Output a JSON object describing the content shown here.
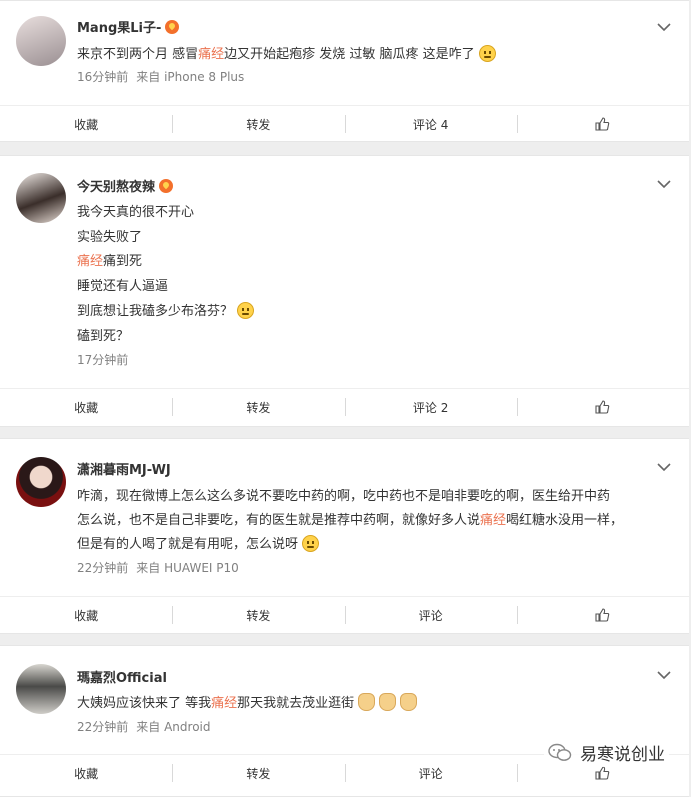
{
  "posts": [
    {
      "username": "Mang果Li子-",
      "lines": [
        [
          "来京不到两个月 感冒",
          "痛经",
          "边又开始起疱疹 发烧 过敏 脑瓜疼 这是咋了"
        ]
      ],
      "time": "16分钟前",
      "source": "来自 iPhone 8 Plus",
      "actions": {
        "favorite": "收藏",
        "repost": "转发",
        "comment": "评论 4"
      }
    },
    {
      "username": "今天别熬夜辣",
      "lines": [
        "我今天真的很不开心",
        "实验失败了",
        "痛经",
        "痛到死",
        "睡觉还有人逼逼",
        "到底想让我磕多少布洛芬？",
        "磕到死？"
      ],
      "time": "17分钟前",
      "source": "",
      "actions": {
        "favorite": "收藏",
        "repost": "转发",
        "comment": "评论 2"
      }
    },
    {
      "username": "潇湘暮雨MJ-WJ",
      "lines": [
        "咋滴，现在微博上怎么这么多说不要吃中药的啊，吃中药也不是咱非要吃的啊，医生给开中药",
        "怎么说，也不是自己非要吃，有的医生就是推荐中药啊，就像好多人说",
        "痛经",
        "喝红糖水没用一样，",
        "但是有的人喝了就是有用呢，怎么说呀"
      ],
      "time": "22分钟前",
      "source": "来自 HUAWEI P10",
      "actions": {
        "favorite": "收藏",
        "repost": "转发",
        "comment": "评论"
      }
    },
    {
      "username": "瑪嘉烈Official",
      "lines": [
        "大姨妈应该快来了 等我",
        "痛经",
        "那天我就去茂业逛街"
      ],
      "time": "22分钟前",
      "source": "来自 Android",
      "actions": {
        "favorite": "收藏",
        "repost": "转发",
        "comment": "评论"
      }
    }
  ],
  "watermark": "易寒说创业",
  "colors": {
    "highlight": "#eb7350",
    "meta": "#808080"
  }
}
